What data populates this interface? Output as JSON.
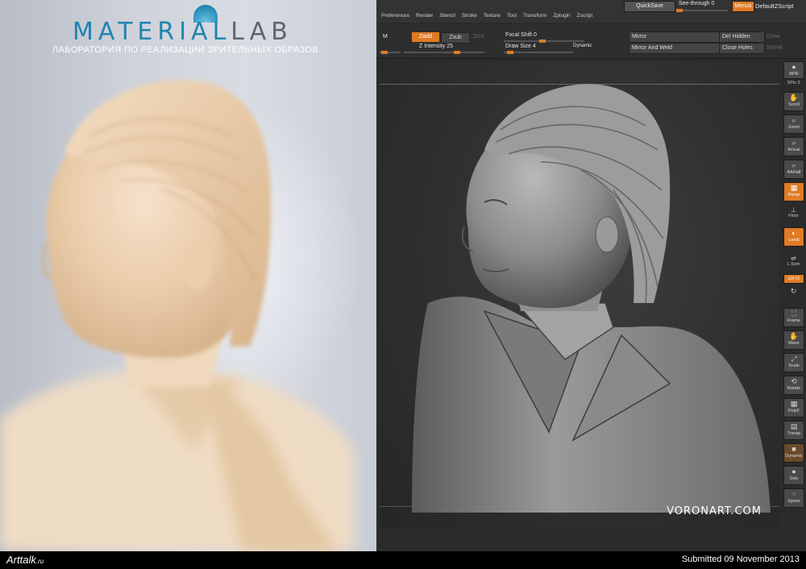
{
  "photo": {
    "logo_main": "MATERIAL",
    "logo_lab": "LAB",
    "logo_subtitle": "ЛАБОРАТОРИЯ ПО РЕАЛИЗАЦИИ ЗРИТЕЛЬНЫХ ОБРАЗОВ"
  },
  "zbrush": {
    "menus": [
      "Preferences",
      "Render",
      "Stencil",
      "Stroke",
      "Texture",
      "Tool",
      "Transform",
      "Zplugin",
      "Zscript"
    ],
    "top": {
      "quicksave": "QuickSave",
      "see_through": "See-through",
      "see_through_value": "0",
      "menus": "Menus",
      "default_zscript": "DefaultZScript"
    },
    "toolbar": {
      "m": "M",
      "zadd": "Zadd",
      "zsub": "Zsub",
      "zcut": "Zcut",
      "z_intensity": "Z Intensity 25",
      "focal_shift": "Focal Shift 0",
      "draw_size": "Draw Size 4",
      "dynamic": "Dynamic",
      "mirror": "Mirror",
      "mirror_weld": "Mirror And Weld",
      "del_hidden": "Del Hidden",
      "close_holes": "Close Holes",
      "grow": "Grow",
      "shrink": "Shrink"
    },
    "shelf": {
      "bpr": "BPR",
      "spix": "SPix 3",
      "scroll": "Scroll",
      "zoom": "Zoom",
      "actual": "Actual",
      "aahalf": "AAHalf",
      "persp": "Persp",
      "floor": "Floor",
      "local": "Local",
      "lsym": "L.Sym",
      "xyz": "QXYZ",
      "frame": "Frame",
      "move": "Move",
      "scale": "Scale",
      "rotate": "Rotate",
      "polyf": "PolyF",
      "transp": "Transp",
      "dynamic": "Dynamic",
      "solo": "Solo",
      "xpose": "Xpose"
    },
    "watermark": "VORONART.COM"
  },
  "footer": {
    "site_logo": "Arttalk",
    "site_logo_tld": ".ru",
    "submitted": "Submitted 09 November 2013"
  },
  "colors": {
    "accent": "#e07b24",
    "panel": "#2b2b2b",
    "brand": "#1e84b0"
  }
}
